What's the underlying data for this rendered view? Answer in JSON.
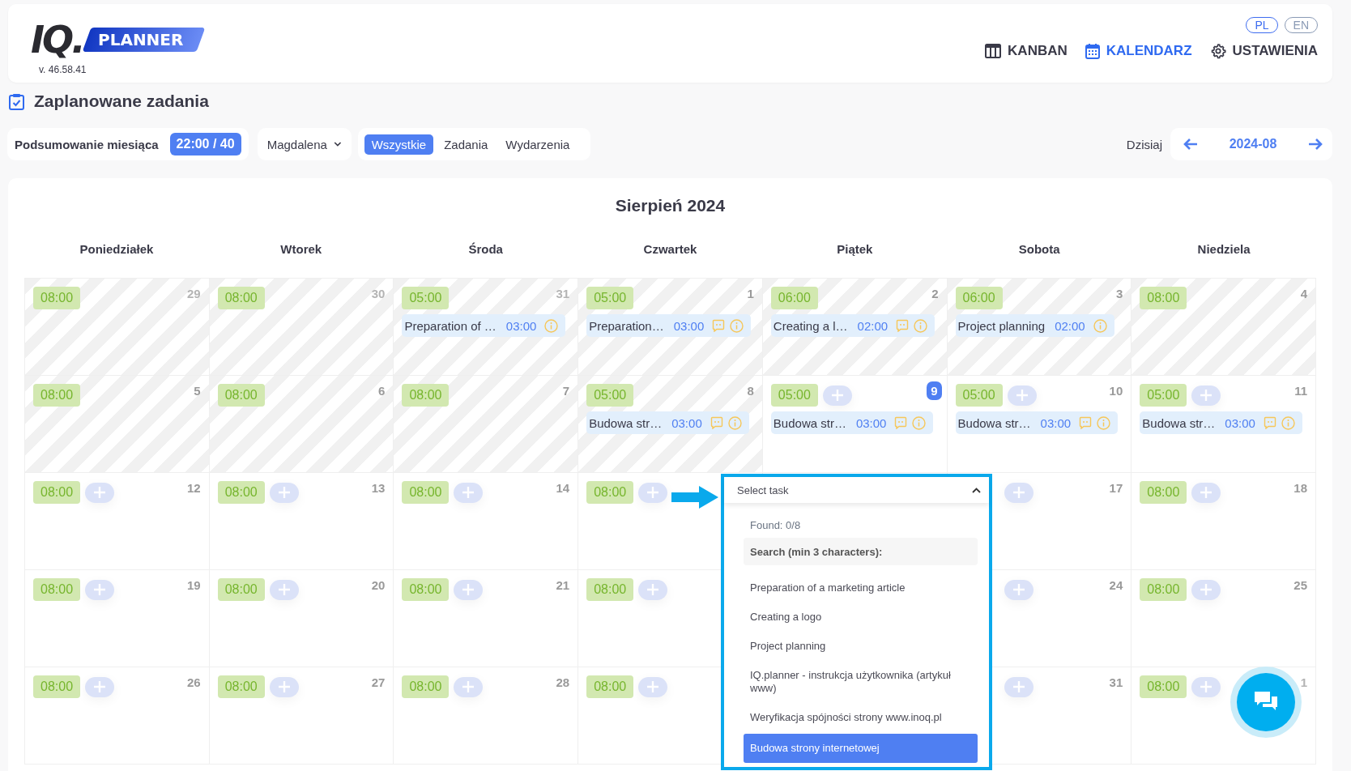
{
  "header": {
    "logo": {
      "mark": "IQ.",
      "name": "PLANNER"
    },
    "version": "v. 46.58.41",
    "languages": [
      {
        "label": "PL",
        "selected": true
      },
      {
        "label": "EN",
        "selected": false
      }
    ],
    "nav": [
      {
        "label": "KANBAN",
        "selected": false
      },
      {
        "label": "KALENDARZ",
        "selected": true
      },
      {
        "label": "USTAWIENIA",
        "selected": false
      }
    ]
  },
  "page_title": "Zaplanowane zadania",
  "toolbar": {
    "summary": {
      "label": "Podsumowanie miesiąca",
      "value": "22:00 / 40"
    },
    "user_select": {
      "value": "Magdalena"
    },
    "filters": [
      {
        "label": "Wszystkie",
        "selected": true
      },
      {
        "label": "Zadania",
        "selected": false
      },
      {
        "label": "Wydarzenia",
        "selected": false
      }
    ],
    "today": "Dzisiaj",
    "period": "2024-08"
  },
  "calendar": {
    "title": "Sierpień 2024",
    "weekdays": [
      "Poniedziałek",
      "Wtorek",
      "Środa",
      "Czwartek",
      "Piątek",
      "Sobota",
      "Niedziela"
    ],
    "weeks": [
      [
        {
          "date": "29",
          "other_month": true,
          "past": true,
          "today": false,
          "hours": "08:00",
          "add": false
        },
        {
          "date": "30",
          "other_month": true,
          "past": true,
          "today": false,
          "hours": "08:00",
          "add": false
        },
        {
          "date": "31",
          "other_month": true,
          "past": true,
          "today": false,
          "hours": "05:00",
          "add": false,
          "tasks": [
            {
              "title": "Preparation of …",
              "time": "03:00",
              "comment": false,
              "info": true
            }
          ]
        },
        {
          "date": "1",
          "other_month": false,
          "past": true,
          "today": false,
          "hours": "05:00",
          "add": false,
          "tasks": [
            {
              "title": "Preparation…",
              "time": "03:00",
              "comment": true,
              "info": true
            }
          ]
        },
        {
          "date": "2",
          "other_month": false,
          "past": true,
          "today": false,
          "hours": "06:00",
          "add": false,
          "tasks": [
            {
              "title": "Creating a l…",
              "time": "02:00",
              "comment": true,
              "info": true
            }
          ]
        },
        {
          "date": "3",
          "other_month": false,
          "past": true,
          "today": false,
          "hours": "06:00",
          "add": false,
          "tasks": [
            {
              "title": "Project planning",
              "time": "02:00",
              "comment": false,
              "info": true
            }
          ]
        },
        {
          "date": "4",
          "other_month": false,
          "past": true,
          "today": false,
          "hours": "08:00",
          "add": false
        }
      ],
      [
        {
          "date": "5",
          "other_month": false,
          "past": true,
          "today": false,
          "hours": "08:00",
          "add": false
        },
        {
          "date": "6",
          "other_month": false,
          "past": true,
          "today": false,
          "hours": "08:00",
          "add": false
        },
        {
          "date": "7",
          "other_month": false,
          "past": true,
          "today": false,
          "hours": "08:00",
          "add": false
        },
        {
          "date": "8",
          "other_month": false,
          "past": true,
          "today": false,
          "hours": "05:00",
          "add": false,
          "tasks": [
            {
              "title": "Budowa str…",
              "time": "03:00",
              "comment": true,
              "info": true
            }
          ]
        },
        {
          "date": "9",
          "other_month": false,
          "past": false,
          "today": true,
          "hours": "05:00",
          "add": true,
          "tasks": [
            {
              "title": "Budowa str…",
              "time": "03:00",
              "comment": true,
              "info": true
            }
          ]
        },
        {
          "date": "10",
          "other_month": false,
          "past": false,
          "today": false,
          "hours": "05:00",
          "add": true,
          "tasks": [
            {
              "title": "Budowa str…",
              "time": "03:00",
              "comment": true,
              "info": true
            }
          ]
        },
        {
          "date": "11",
          "other_month": false,
          "past": false,
          "today": false,
          "hours": "05:00",
          "add": true,
          "tasks": [
            {
              "title": "Budowa str…",
              "time": "03:00",
              "comment": true,
              "info": true
            }
          ]
        }
      ],
      [
        {
          "date": "12",
          "other_month": false,
          "past": false,
          "today": false,
          "hours": "08:00",
          "add": true
        },
        {
          "date": "13",
          "other_month": false,
          "past": false,
          "today": false,
          "hours": "08:00",
          "add": true
        },
        {
          "date": "14",
          "other_month": false,
          "past": false,
          "today": false,
          "hours": "08:00",
          "add": true
        },
        {
          "past": false,
          "hours": "08:00",
          "add": true
        },
        {
          "date": "17",
          "other_month": false,
          "past": false,
          "today": false,
          "add": true
        },
        {
          "date": "18",
          "other_month": false,
          "past": false,
          "today": false,
          "hours": "08:00",
          "add": true
        }
      ],
      [
        {
          "date": "19",
          "other_month": false,
          "past": false,
          "today": false,
          "hours": "08:00",
          "add": true
        },
        {
          "date": "20",
          "other_month": false,
          "past": false,
          "today": false,
          "hours": "08:00",
          "add": true
        },
        {
          "date": "21",
          "other_month": false,
          "past": false,
          "today": false,
          "hours": "08:00",
          "add": true
        },
        {
          "past": false,
          "hours": "08:00",
          "add": true
        },
        {
          "date": "24",
          "other_month": false,
          "past": false,
          "today": false,
          "add": true
        },
        {
          "date": "25",
          "other_month": false,
          "past": false,
          "today": false,
          "hours": "08:00",
          "add": true
        }
      ],
      [
        {
          "date": "26",
          "other_month": false,
          "past": false,
          "today": false,
          "hours": "08:00",
          "add": true
        },
        {
          "date": "27",
          "other_month": false,
          "past": false,
          "today": false,
          "hours": "08:00",
          "add": true
        },
        {
          "date": "28",
          "other_month": false,
          "past": false,
          "today": false,
          "hours": "08:00",
          "add": true
        },
        {
          "past": false,
          "hours": "08:00",
          "add": true
        },
        {
          "date": "31",
          "other_month": false,
          "past": false,
          "today": false,
          "add": true
        },
        {
          "date": "1",
          "other_month": true,
          "past": false,
          "today": false,
          "hours": "08:00",
          "add": true
        }
      ]
    ]
  },
  "task_picker": {
    "placeholder": "Select task",
    "expanded": true,
    "found": "Found: 0/8",
    "search": {
      "placeholder": "Search (min 3 characters):"
    },
    "options": [
      {
        "label": "Preparation of a marketing article",
        "selected": false
      },
      {
        "label": "Creating a logo",
        "selected": false
      },
      {
        "label": "Project planning",
        "selected": false
      },
      {
        "label": "IQ.planner - instrukcja użytkownika (artykuł www)",
        "selected": false
      },
      {
        "label": "Weryfikacja spójności strony www.inoq.pl",
        "selected": false
      },
      {
        "label": "Budowa strony internetowej",
        "selected": true
      }
    ]
  }
}
